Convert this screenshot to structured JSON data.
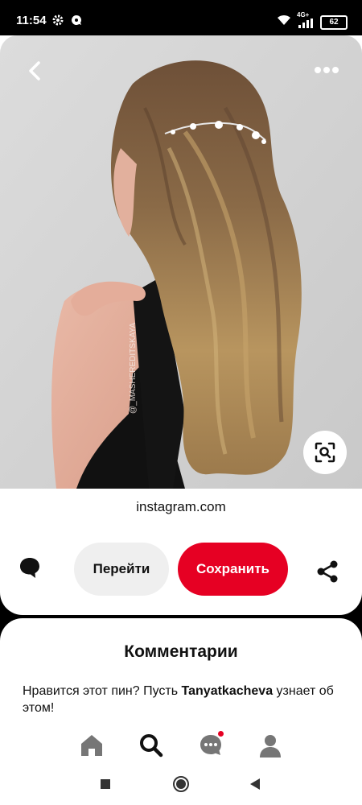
{
  "status_bar": {
    "time": "11:54",
    "network": "4G+",
    "battery": "62"
  },
  "pin": {
    "source": "instagram.com",
    "watermark": "@_MASHEREDITSKAYA"
  },
  "actions": {
    "visit_label": "Перейти",
    "save_label": "Сохранить"
  },
  "comments": {
    "title": "Комментарии",
    "prompt_before": "Нравится этот пин? Пусть ",
    "prompt_user": "Tanyatkacheva",
    "prompt_after": " узнает об этом!"
  },
  "bottom_nav": {
    "items": [
      "home-icon",
      "search-icon",
      "messages-icon",
      "profile-icon"
    ],
    "messages_notification": true
  },
  "colors": {
    "accent": "#e60023",
    "button_gray": "#efefef",
    "text": "#111111"
  }
}
